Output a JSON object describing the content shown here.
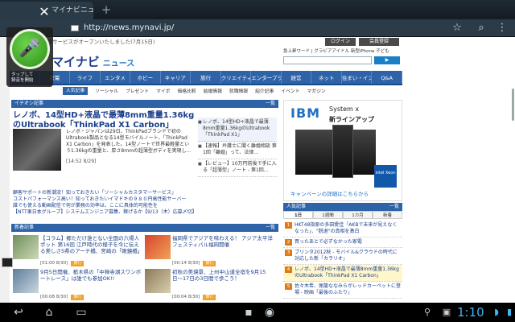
{
  "tab": {
    "title": "マイナビニュース",
    "add": "+"
  },
  "urlbar": {
    "url": "http://news.mynavi.jp/"
  },
  "voice": {
    "caption": "タップして\n録音を開始"
  },
  "ticker": "話題サービスがオープンいたしました(7月15日)",
  "header": {
    "login": "ログイン",
    "register": "会員登録",
    "logo": "マイナビ",
    "logo_suffix": "ニュース",
    "search_label": "急上昇ワード | グラビアアイドル  新型iPhone  子ども"
  },
  "nav": [
    "携帯",
    "家電",
    "ライフ",
    "エンタメ",
    "ホビー",
    "キャリア",
    "旅行",
    "クリエイティブ",
    "エンタープライズ",
    "経営",
    "ネット",
    "住まい・インテリア",
    "Q&A"
  ],
  "subnav": {
    "active": "人気記事",
    "items": [
      "ソーシャル",
      "プレゼント",
      "マイボ",
      "価格比較",
      "結婚情報",
      "就職情報",
      "紹介記事",
      "イベント",
      "マガジン"
    ]
  },
  "sections": {
    "editor": "イチオシ記事",
    "latest": "一覧",
    "new_articles": "新着記事",
    "ranking": "人気記事"
  },
  "lead": {
    "title": "レノボ、14型HD+液晶で最薄8mm重量1.36kgのUltrabook「ThinkPad X1 Carbon」",
    "body": "レノボ・ジャパンは29日、ThinkPadブランドで初のUltrabook製品となる14型モバイルノート、「ThinkPad X1 Carbon」を発表した。14型ノートで世界最軽量という1.36kgの重量と、厚さ8mmの超薄型ボディを実現し...",
    "date": "[14:52 8/29]"
  },
  "side_list": {
    "top": "レノボ、14型HD+液晶で最薄8mm重量1.36kgのUltrabook「ThinkPad X1」",
    "items": [
      "【速報】弁護士に聞く離婚相談 第1回「離婚」って、法律...",
      "【レビュー】10万円前後で手に入る「超薄型」ノート - 第1回..."
    ]
  },
  "promo": "顧客サポートの新潮流！知っておきたい「ソーシャルカスタマーサービス」\nコストパフォーマンス高い！知っておきたいイマドキの９８０円高性能サーバー\n誰でも使える動画配信で何が業務の効率は、ここに具体的可能性を\n【NTT東日本グループ】システムエンジニア募集、稼げるか【9/13（木）応募〆切】",
  "grid": [
    {
      "title": "【コラム】郷ただけ誰とない全国の六場人ポット 第16回 江戸時代の様子を今に伝える美しさ5県のアーチ橋、宮崎の「眼鏡橋」",
      "date": "[01:00 8/30]",
      "badge": "旅行"
    },
    {
      "title": "福岡県でアジアを味わえる！ アジア太平洋フェスティバル福岡開催",
      "date": "[00:14 8/30]",
      "badge": "旅行"
    },
    {
      "title": "9月5日開催、栃木県の「中禅寺湖スワンボートレース」は誰でも参加OK!!",
      "date": "[00:08 8/30]",
      "badge": "旅行"
    },
    {
      "title": "初秋の美瑛景、上州中山道全宿を9月15日〜17日の3日間で歩こう！",
      "date": "[00:04 8/30]",
      "badge": "旅行"
    }
  ],
  "ad": {
    "brand": "IBM",
    "line1": "System x",
    "line2": "新ラインアップ",
    "cta": "キャンペーンの詳細はこちらから",
    "chip": "intel Xeon"
  },
  "ranking": {
    "tabs": [
      "1日",
      "1週間",
      "1カ月",
      "新着"
    ],
    "rows": [
      {
        "n": "1",
        "text": "HKT48指原の多田愛佳「AKBで未来が見えなくなった」、\"脱退\"の真相を激白"
      },
      {
        "n": "2",
        "text": "買ったあとで必ずなかった家電"
      },
      {
        "n": "3",
        "text": "ブリンタ2012秋 - モバイル&クラウドの時代に対応した新「カラリオ」"
      },
      {
        "n": "4",
        "text": "レノボ、14型HD+液晶で最薄8mm重量1.36kgのUltrabook「ThinkPad X1 Carbon」"
      },
      {
        "n": "5",
        "text": "佐々木希、尾籠ななみらがレッドカーペットに登場 - 映画「最後のふたり」"
      }
    ]
  },
  "status": {
    "clock": "1:10"
  }
}
